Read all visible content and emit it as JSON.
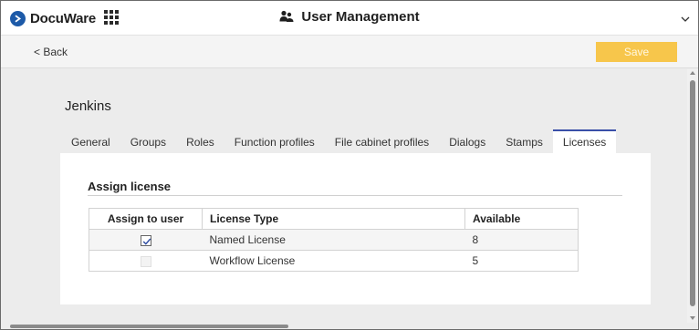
{
  "header": {
    "logo_text": "DocuWare",
    "app_title": "User Management"
  },
  "toolbar": {
    "back_label": "< Back",
    "save_label": "Save"
  },
  "user": {
    "name": "Jenkins"
  },
  "tabs": [
    {
      "label": "General",
      "active": false
    },
    {
      "label": "Groups",
      "active": false
    },
    {
      "label": "Roles",
      "active": false
    },
    {
      "label": "Function profiles",
      "active": false
    },
    {
      "label": "File cabinet profiles",
      "active": false
    },
    {
      "label": "Dialogs",
      "active": false
    },
    {
      "label": "Stamps",
      "active": false
    },
    {
      "label": "Licenses",
      "active": true
    }
  ],
  "licenses": {
    "section_title": "Assign license",
    "columns": [
      "Assign to user",
      "License Type",
      "Available"
    ],
    "rows": [
      {
        "assigned": true,
        "enabled": true,
        "type": "Named License",
        "available": "8"
      },
      {
        "assigned": false,
        "enabled": false,
        "type": "Workflow License",
        "available": "5"
      }
    ]
  },
  "colors": {
    "save_button": "#f7c64b",
    "active_tab_accent": "#3a4fa8",
    "logo_mark": "#1d5aa8"
  }
}
